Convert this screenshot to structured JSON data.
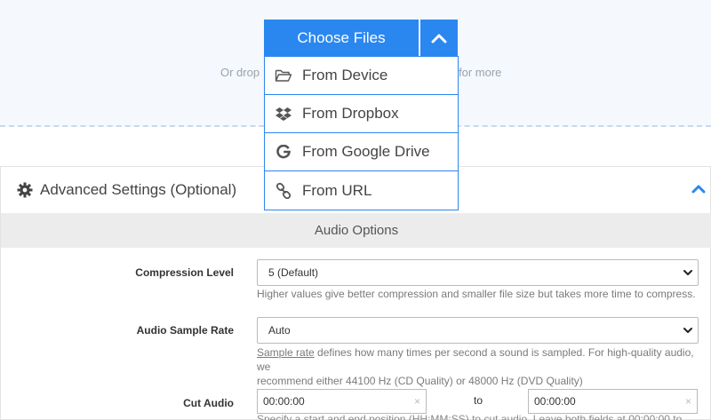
{
  "upload": {
    "choose_label": "Choose Files",
    "drop_text_left": "Or drop",
    "drop_text_right": "for more",
    "menu": [
      {
        "label": "From Device",
        "icon": "folder-open-icon"
      },
      {
        "label": "From Dropbox",
        "icon": "dropbox-icon"
      },
      {
        "label": "From Google Drive",
        "icon": "google-icon"
      },
      {
        "label": "From URL",
        "icon": "link-icon"
      }
    ]
  },
  "advanced": {
    "title": "Advanced Settings (Optional)",
    "section_title": "Audio Options",
    "compression": {
      "label": "Compression Level",
      "value": "5 (Default)",
      "help": "Higher values give better compression and smaller file size but takes more time to compress."
    },
    "sample_rate": {
      "label": "Audio Sample Rate",
      "value": "Auto",
      "help_link": "Sample rate",
      "help_line1": " defines how many times per second a sound is sampled. For high-quality audio, we",
      "help_line2": "recommend either 44100 Hz (CD Quality) or 48000 Hz (DVD Quality)"
    },
    "cut_audio": {
      "label": "Cut Audio",
      "start": "00:00:00",
      "to_label": "to",
      "end": "00:00:00",
      "clear": "×",
      "help": "Specify a start and end position (HH:MM:SS) to cut audio. Leave both fields at 00:00:00 to"
    }
  },
  "colors": {
    "accent": "#2b87f0",
    "dropzone_bg": "#f5f8fd",
    "section_bg": "#ececec"
  }
}
